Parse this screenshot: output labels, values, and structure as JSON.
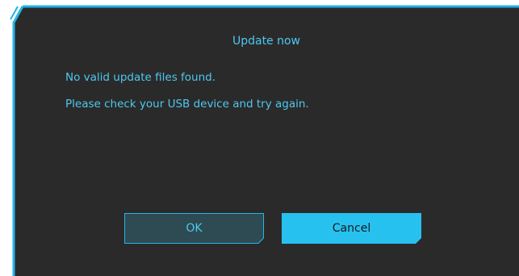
{
  "dialog": {
    "title": "Update now",
    "message_lines": [
      "No valid update files found.",
      "Please check your USB device and try again."
    ],
    "buttons": {
      "ok_label": "OK",
      "cancel_label": "Cancel"
    }
  },
  "colors": {
    "background": "#2b2a2a",
    "accent": "#4cc9f0",
    "frame": "#22b4e6",
    "ok_fill": "#2e4a52",
    "cancel_fill": "#27c1f0"
  }
}
